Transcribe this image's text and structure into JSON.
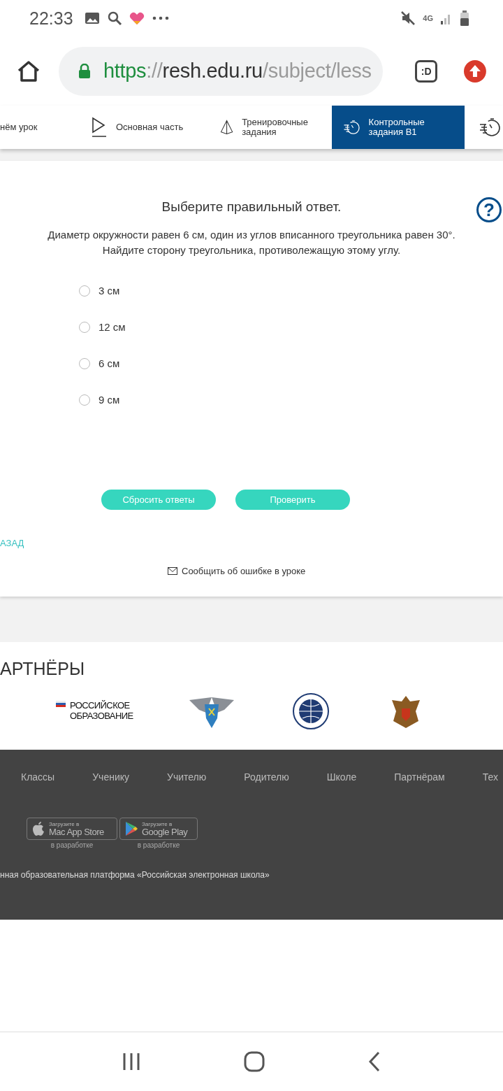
{
  "status_bar": {
    "time": "22:33",
    "network": "4G"
  },
  "browser": {
    "url": [
      {
        "kind": "scheme",
        "text": "https"
      },
      {
        "kind": "sep",
        "text": "://"
      },
      {
        "kind": "host",
        "text": "resh.edu.ru"
      },
      {
        "kind": "path",
        "text": "/subject/less"
      }
    ],
    "tab_button": ":D"
  },
  "lesson_tabs": [
    {
      "label": "нём урок",
      "selected": false
    },
    {
      "label": "Основная часть",
      "selected": false
    },
    {
      "label": "Тренировочные задания",
      "selected": false
    },
    {
      "label": "Контрольные задания В1",
      "selected": true
    },
    {
      "selected": false
    }
  ],
  "task": {
    "heading": "Выберите правильный ответ.",
    "help": "?",
    "question": "Диаметр окружности равен 6 см, один из углов вписанного треугольника равен 30°. Найдите сторону треугольника, противолежащую этому углу.",
    "options": [
      {
        "label": "3 см",
        "selected": false
      },
      {
        "label": "12 см",
        "selected": false
      },
      {
        "label": "6 см",
        "selected": false
      },
      {
        "label": "9 см",
        "selected": false
      }
    ],
    "buttons": [
      "Сбросить ответы",
      "Проверить"
    ],
    "back_link": "АЗАД",
    "report_link": "Сообщить об ошибке в уроке"
  },
  "partners": {
    "title": "АРТНЁРЫ",
    "logos": [
      {
        "kind": "text",
        "lines": [
          "РОССИЙСКОЕ",
          "ОБРАЗОВАНИЕ"
        ]
      },
      {
        "kind": "eagle"
      },
      {
        "kind": "globe"
      },
      {
        "kind": "crest"
      }
    ]
  },
  "footer": {
    "nav": [
      "Классы",
      "Ученику",
      "Учителю",
      "Родителю",
      "Школе",
      "Партнёрам",
      "Тех"
    ],
    "stores": [
      {
        "kind": "apple",
        "small": "Загрузите в",
        "name": "Mac App Store",
        "caption": "в разработке"
      },
      {
        "kind": "google",
        "small": "Загрузите в",
        "name": "Google Play",
        "caption": "в разработке"
      }
    ],
    "copyright": "нная образовательная платформа «Российская электронная школа»"
  }
}
